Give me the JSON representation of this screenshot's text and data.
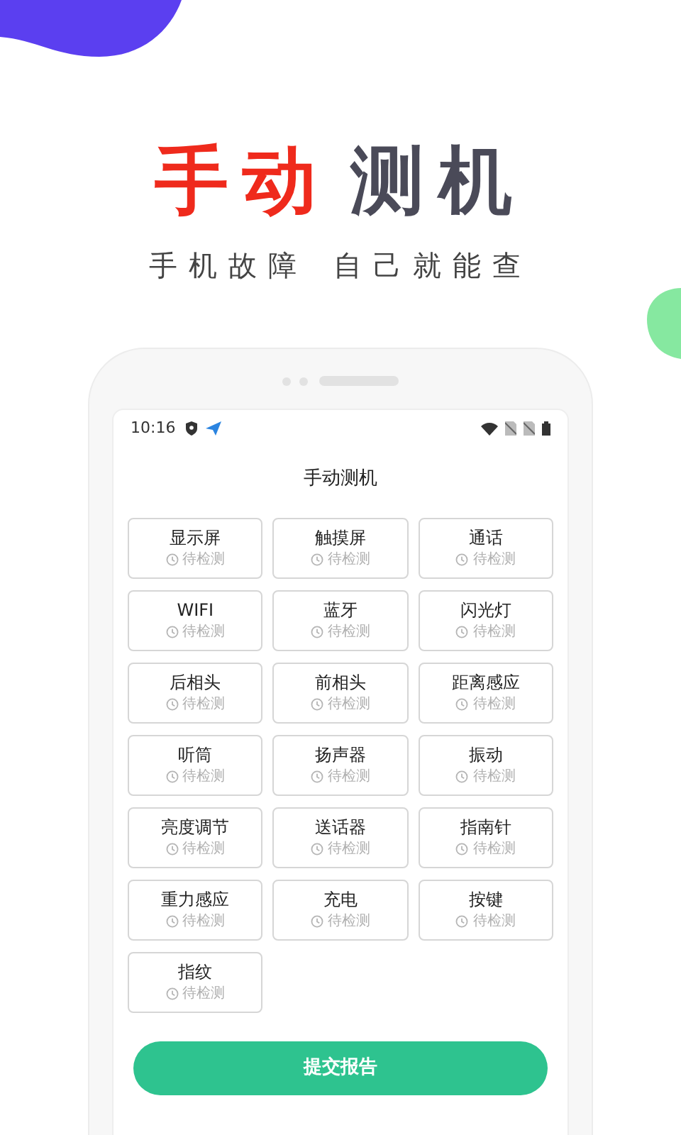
{
  "headline": {
    "accent": "手动",
    "rest": "测机"
  },
  "subtitle": [
    "手机故障",
    "自己就能查"
  ],
  "phone": {
    "status_bar": {
      "time": "10:16"
    },
    "title": "手动测机",
    "tests": [
      {
        "name": "显示屏",
        "status": "待检测"
      },
      {
        "name": "触摸屏",
        "status": "待检测"
      },
      {
        "name": "通话",
        "status": "待检测"
      },
      {
        "name": "WIFI",
        "status": "待检测"
      },
      {
        "name": "蓝牙",
        "status": "待检测"
      },
      {
        "name": "闪光灯",
        "status": "待检测"
      },
      {
        "name": "后相头",
        "status": "待检测"
      },
      {
        "name": "前相头",
        "status": "待检测"
      },
      {
        "name": "距离感应",
        "status": "待检测"
      },
      {
        "name": "听筒",
        "status": "待检测"
      },
      {
        "name": "扬声器",
        "status": "待检测"
      },
      {
        "name": "振动",
        "status": "待检测"
      },
      {
        "name": "亮度调节",
        "status": "待检测"
      },
      {
        "name": "送话器",
        "status": "待检测"
      },
      {
        "name": "指南针",
        "status": "待检测"
      },
      {
        "name": "重力感应",
        "status": "待检测"
      },
      {
        "name": "充电",
        "status": "待检测"
      },
      {
        "name": "按键",
        "status": "待检测"
      },
      {
        "name": "指纹",
        "status": "待检测"
      }
    ],
    "submit_button": "提交报告"
  }
}
